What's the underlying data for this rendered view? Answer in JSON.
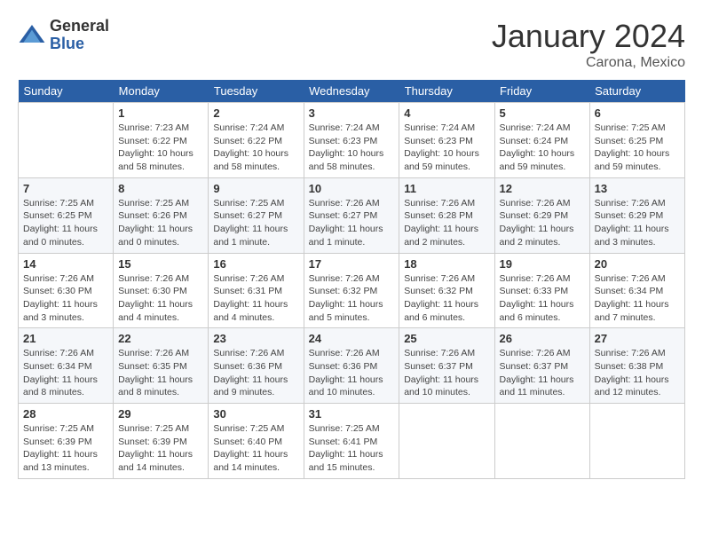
{
  "header": {
    "logo_general": "General",
    "logo_blue": "Blue",
    "month_title": "January 2024",
    "location": "Carona, Mexico"
  },
  "days_of_week": [
    "Sunday",
    "Monday",
    "Tuesday",
    "Wednesday",
    "Thursday",
    "Friday",
    "Saturday"
  ],
  "weeks": [
    [
      {
        "day": "",
        "info": ""
      },
      {
        "day": "1",
        "info": "Sunrise: 7:23 AM\nSunset: 6:22 PM\nDaylight: 10 hours\nand 58 minutes."
      },
      {
        "day": "2",
        "info": "Sunrise: 7:24 AM\nSunset: 6:22 PM\nDaylight: 10 hours\nand 58 minutes."
      },
      {
        "day": "3",
        "info": "Sunrise: 7:24 AM\nSunset: 6:23 PM\nDaylight: 10 hours\nand 58 minutes."
      },
      {
        "day": "4",
        "info": "Sunrise: 7:24 AM\nSunset: 6:23 PM\nDaylight: 10 hours\nand 59 minutes."
      },
      {
        "day": "5",
        "info": "Sunrise: 7:24 AM\nSunset: 6:24 PM\nDaylight: 10 hours\nand 59 minutes."
      },
      {
        "day": "6",
        "info": "Sunrise: 7:25 AM\nSunset: 6:25 PM\nDaylight: 10 hours\nand 59 minutes."
      }
    ],
    [
      {
        "day": "7",
        "info": "Sunrise: 7:25 AM\nSunset: 6:25 PM\nDaylight: 11 hours\nand 0 minutes."
      },
      {
        "day": "8",
        "info": "Sunrise: 7:25 AM\nSunset: 6:26 PM\nDaylight: 11 hours\nand 0 minutes."
      },
      {
        "day": "9",
        "info": "Sunrise: 7:25 AM\nSunset: 6:27 PM\nDaylight: 11 hours\nand 1 minute."
      },
      {
        "day": "10",
        "info": "Sunrise: 7:26 AM\nSunset: 6:27 PM\nDaylight: 11 hours\nand 1 minute."
      },
      {
        "day": "11",
        "info": "Sunrise: 7:26 AM\nSunset: 6:28 PM\nDaylight: 11 hours\nand 2 minutes."
      },
      {
        "day": "12",
        "info": "Sunrise: 7:26 AM\nSunset: 6:29 PM\nDaylight: 11 hours\nand 2 minutes."
      },
      {
        "day": "13",
        "info": "Sunrise: 7:26 AM\nSunset: 6:29 PM\nDaylight: 11 hours\nand 3 minutes."
      }
    ],
    [
      {
        "day": "14",
        "info": "Sunrise: 7:26 AM\nSunset: 6:30 PM\nDaylight: 11 hours\nand 3 minutes."
      },
      {
        "day": "15",
        "info": "Sunrise: 7:26 AM\nSunset: 6:30 PM\nDaylight: 11 hours\nand 4 minutes."
      },
      {
        "day": "16",
        "info": "Sunrise: 7:26 AM\nSunset: 6:31 PM\nDaylight: 11 hours\nand 4 minutes."
      },
      {
        "day": "17",
        "info": "Sunrise: 7:26 AM\nSunset: 6:32 PM\nDaylight: 11 hours\nand 5 minutes."
      },
      {
        "day": "18",
        "info": "Sunrise: 7:26 AM\nSunset: 6:32 PM\nDaylight: 11 hours\nand 6 minutes."
      },
      {
        "day": "19",
        "info": "Sunrise: 7:26 AM\nSunset: 6:33 PM\nDaylight: 11 hours\nand 6 minutes."
      },
      {
        "day": "20",
        "info": "Sunrise: 7:26 AM\nSunset: 6:34 PM\nDaylight: 11 hours\nand 7 minutes."
      }
    ],
    [
      {
        "day": "21",
        "info": "Sunrise: 7:26 AM\nSunset: 6:34 PM\nDaylight: 11 hours\nand 8 minutes."
      },
      {
        "day": "22",
        "info": "Sunrise: 7:26 AM\nSunset: 6:35 PM\nDaylight: 11 hours\nand 8 minutes."
      },
      {
        "day": "23",
        "info": "Sunrise: 7:26 AM\nSunset: 6:36 PM\nDaylight: 11 hours\nand 9 minutes."
      },
      {
        "day": "24",
        "info": "Sunrise: 7:26 AM\nSunset: 6:36 PM\nDaylight: 11 hours\nand 10 minutes."
      },
      {
        "day": "25",
        "info": "Sunrise: 7:26 AM\nSunset: 6:37 PM\nDaylight: 11 hours\nand 10 minutes."
      },
      {
        "day": "26",
        "info": "Sunrise: 7:26 AM\nSunset: 6:37 PM\nDaylight: 11 hours\nand 11 minutes."
      },
      {
        "day": "27",
        "info": "Sunrise: 7:26 AM\nSunset: 6:38 PM\nDaylight: 11 hours\nand 12 minutes."
      }
    ],
    [
      {
        "day": "28",
        "info": "Sunrise: 7:25 AM\nSunset: 6:39 PM\nDaylight: 11 hours\nand 13 minutes."
      },
      {
        "day": "29",
        "info": "Sunrise: 7:25 AM\nSunset: 6:39 PM\nDaylight: 11 hours\nand 14 minutes."
      },
      {
        "day": "30",
        "info": "Sunrise: 7:25 AM\nSunset: 6:40 PM\nDaylight: 11 hours\nand 14 minutes."
      },
      {
        "day": "31",
        "info": "Sunrise: 7:25 AM\nSunset: 6:41 PM\nDaylight: 11 hours\nand 15 minutes."
      },
      {
        "day": "",
        "info": ""
      },
      {
        "day": "",
        "info": ""
      },
      {
        "day": "",
        "info": ""
      }
    ]
  ]
}
